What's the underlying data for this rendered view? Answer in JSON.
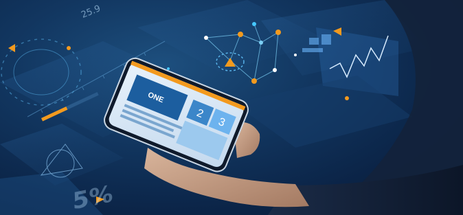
{
  "scene": {
    "top_readout": "25.9",
    "percent_readout": "5%",
    "phone": {
      "brand": "ONE",
      "tile_numbers": [
        "2",
        "3"
      ]
    },
    "colors": {
      "accent_orange": "#f39a1e",
      "glow_cyan": "#46c8ff",
      "panel_blue": "#1b4f86"
    }
  }
}
